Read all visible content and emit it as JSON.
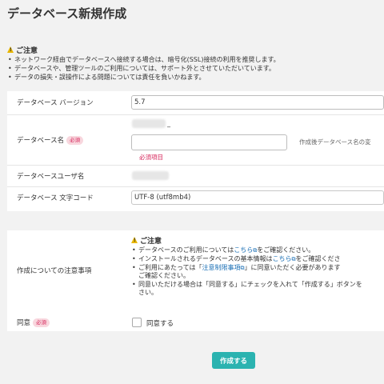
{
  "page": {
    "title": "データベース新規作成"
  },
  "notice": {
    "heading": "ご注意",
    "items": [
      "ネットワーク経由でデータベースへ接続する場合は、暗号化(SSL)接続の利用を推奨します。",
      "データベースや、管理ツールのご利用については、サポート外とさせていただいています。",
      "データの損失・誤操作による問題については責任を負いかねます。"
    ]
  },
  "form": {
    "version": {
      "label": "データベース バージョン",
      "value": "5.7"
    },
    "db_name": {
      "label": "データベース名",
      "badge": "必須",
      "prefix_suffix": "_",
      "value": "",
      "hint": "作成後データベース名の変",
      "error": "必須項目"
    },
    "db_user": {
      "label": "データベースユーザ名"
    },
    "charset": {
      "label": "データベース 文字コード",
      "value": "UTF-8 (utf8mb4)"
    },
    "caution": {
      "label": "作成についての注意事項",
      "heading": "ご注意",
      "item1": {
        "pre": "データベースのご利用については",
        "link": "こちら",
        "post": "をご確認ください。"
      },
      "item2": {
        "pre": "インストールされるデータベースの基本情報は",
        "link": "こちら",
        "post": "をご確認くださ"
      },
      "item3": {
        "pre": "ご利用にあたっては「",
        "link": "注意制限事項",
        "post": "」に同意いただく必要があります",
        "line2": "ご確認ください。"
      },
      "item4": {
        "line1": "同意いただける場合は「同意する」にチェックを入れて「作成する」ボタンを",
        "line2": "さい。"
      }
    },
    "agree": {
      "label": "同意",
      "badge": "必須",
      "checkbox_label": "同意する",
      "checked": false
    }
  },
  "actions": {
    "submit_label": "作成する"
  },
  "colors": {
    "accent": "#2bb3b0",
    "required": "#d6245a",
    "link": "#1a6fb5",
    "warning": "#e8b600"
  }
}
